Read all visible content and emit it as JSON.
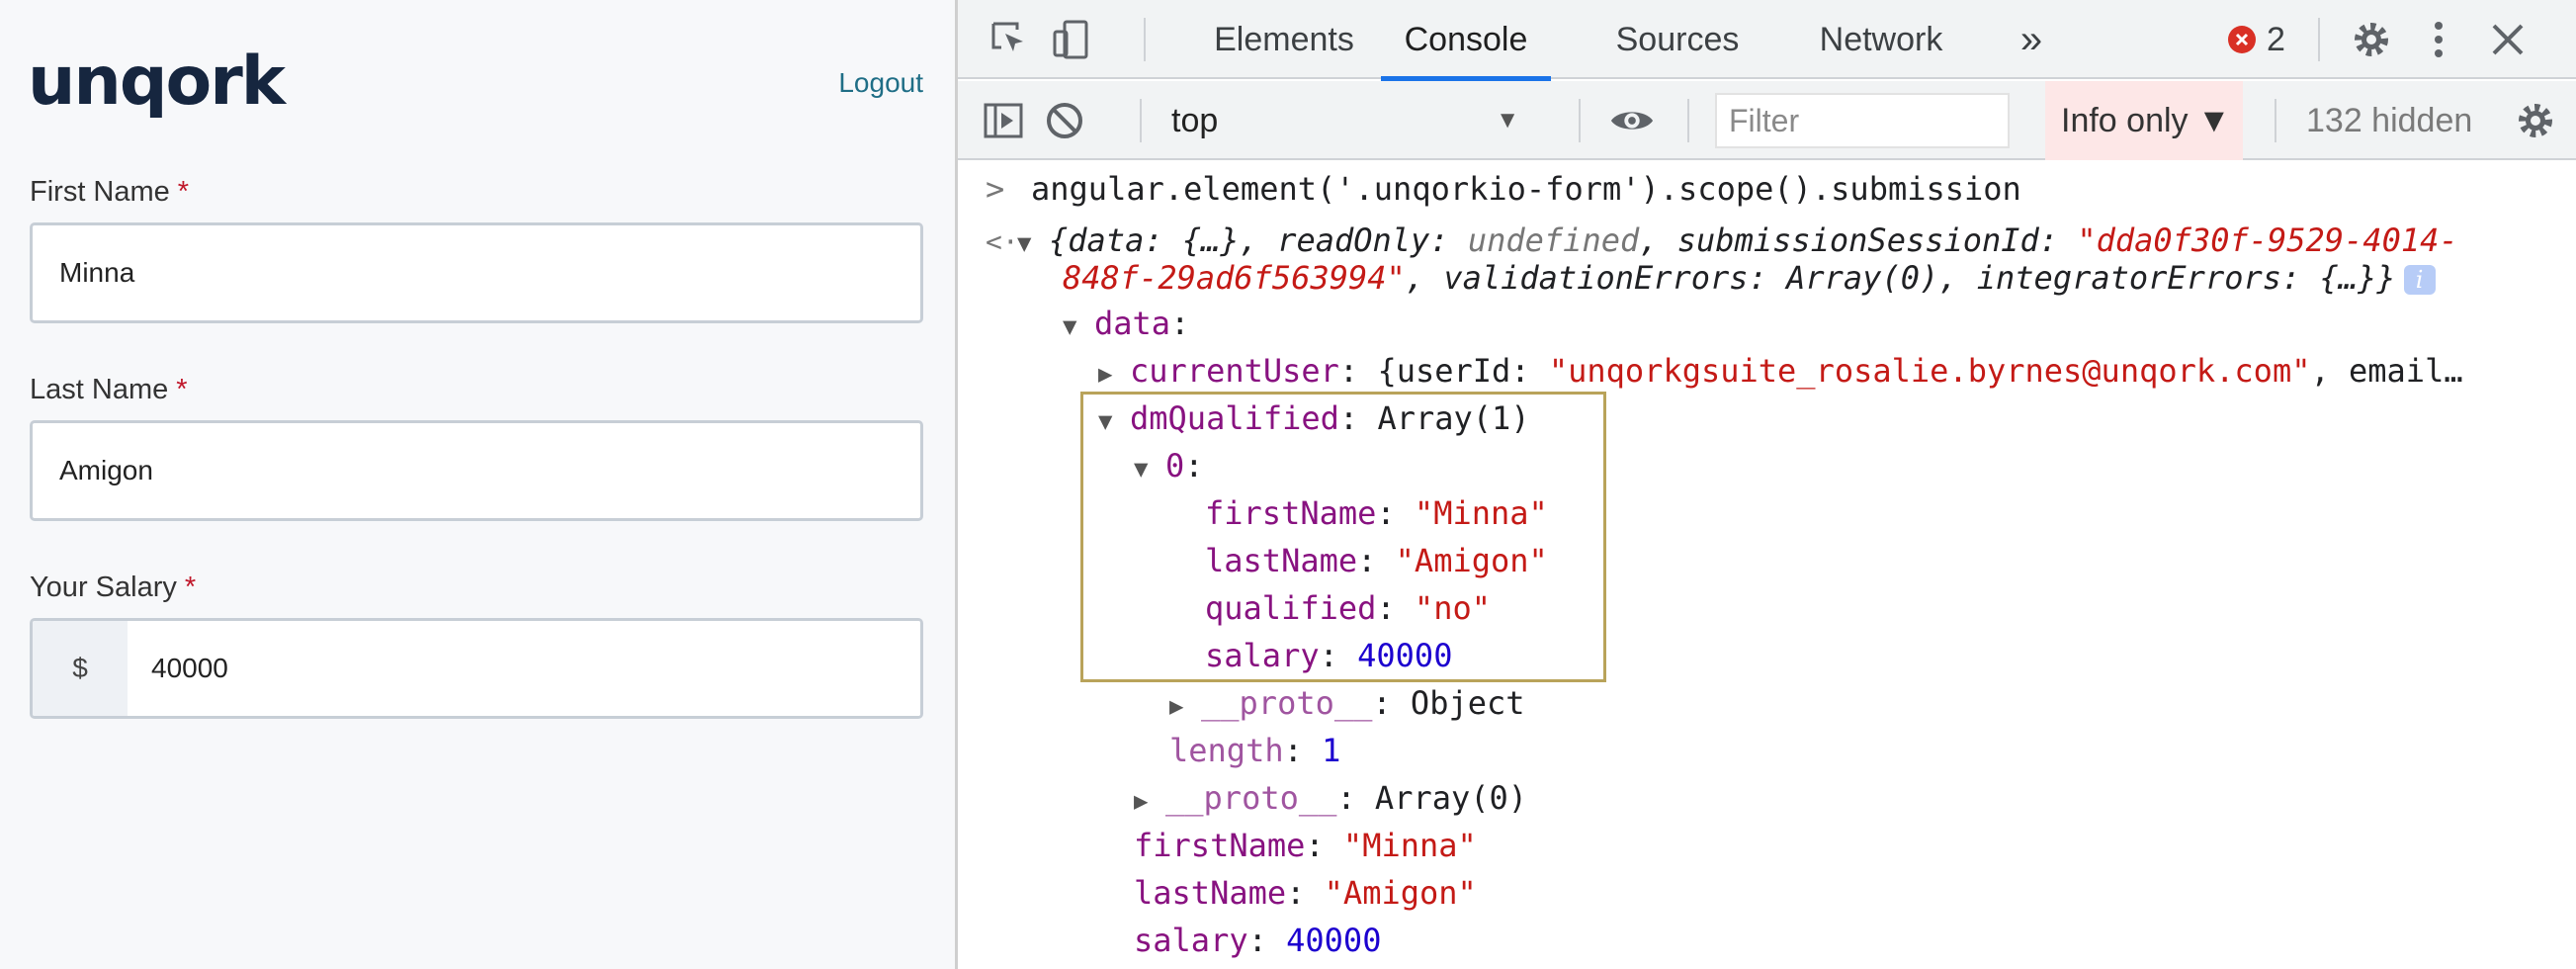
{
  "app": {
    "logo": "unqork",
    "logout": "Logout",
    "fields": [
      {
        "label": "First Name",
        "required": "*",
        "value": "Minna"
      },
      {
        "label": "Last Name",
        "required": "*",
        "value": "Amigon"
      },
      {
        "label": "Your Salary",
        "required": "*",
        "prefix": "$",
        "value": "40000"
      }
    ]
  },
  "devtools": {
    "tabs": [
      "Elements",
      "Console",
      "Sources",
      "Network"
    ],
    "active_tab": "Console",
    "more": "»",
    "error_count": "2",
    "toolbar": {
      "context": "top",
      "filter_placeholder": "Filter",
      "levels": "Info only ▼",
      "hidden": "132 hidden"
    },
    "console": {
      "command": "angular.element('.unqorkio-form').scope().submission",
      "summary": {
        "l1_a": "{data: {…}, readOnly: ",
        "l1_undef": "undefined",
        "l1_b": ", submissionSessionId: ",
        "l1_str": "\"dda0f30f-9529-4014-",
        "l2_str": "848f-29ad6f563994\"",
        "l2_b": ", validationErrors: Array(0), integratorErrors: {…}}"
      },
      "data_key": "data",
      "current_user_key": "currentUser",
      "current_user_a": "{userId: ",
      "current_user_str": "\"unqorkgsuite_rosalie.byrnes@unqork.com\"",
      "current_user_b": ", email…",
      "dm_key": "dmQualified",
      "dm_val": "Array(1)",
      "index_key": "0",
      "props": [
        {
          "key": "firstName",
          "value": "\"Minna\"",
          "type": "str"
        },
        {
          "key": "lastName",
          "value": "\"Amigon\"",
          "type": "str"
        },
        {
          "key": "qualified",
          "value": "\"no\"",
          "type": "str"
        },
        {
          "key": "salary",
          "value": "40000",
          "type": "num"
        }
      ],
      "proto_obj_key": "__proto__",
      "proto_obj_val": "Object",
      "length_key": "length",
      "length_val": "1",
      "proto_arr_key": "__proto__",
      "proto_arr_val": "Array(0)",
      "root_props": [
        {
          "key": "firstName",
          "value": "\"Minna\"",
          "type": "str"
        },
        {
          "key": "lastName",
          "value": "\"Amigon\"",
          "type": "str"
        },
        {
          "key": "salary",
          "value": "40000",
          "type": "num"
        }
      ]
    }
  },
  "colors": {
    "logo": "#16263f",
    "link": "#1f6e86",
    "required": "#c0182b",
    "active_tab": "#1a73e8",
    "highlight_box": "#b9a35a",
    "error_icon": "#d93025"
  }
}
